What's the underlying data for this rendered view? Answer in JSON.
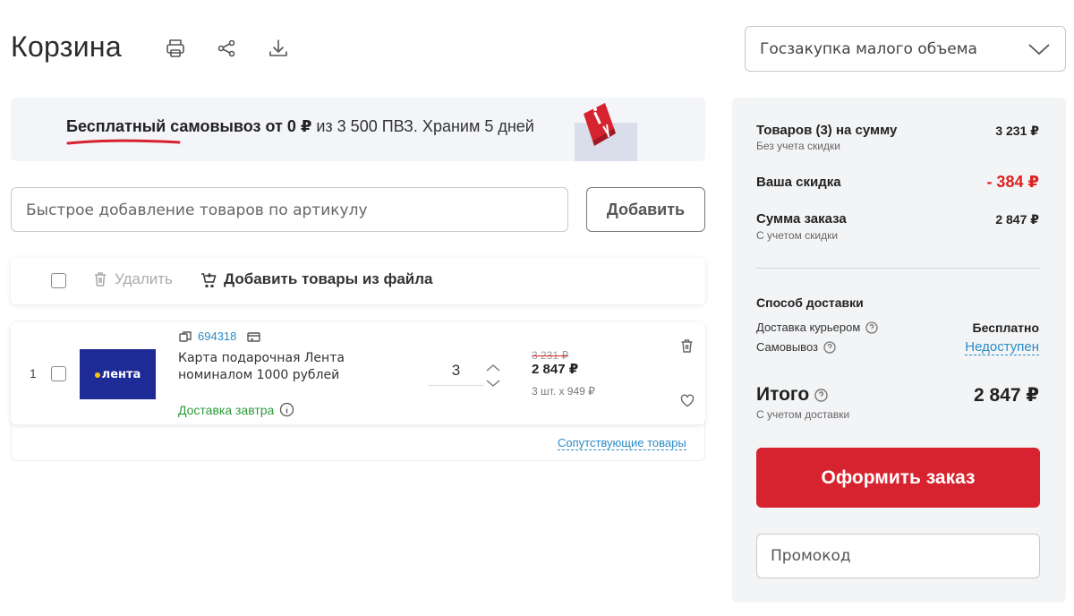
{
  "header": {
    "title": "Корзина",
    "icons": [
      "print-icon",
      "share-icon",
      "download-icon"
    ]
  },
  "purchase_type": {
    "selected": "Госзакупка малого объема"
  },
  "banner": {
    "bold_text": "Бесплатный самовывоз от 0 ₽",
    "text": " из 3 500 ПВЗ. Храним 5 дней"
  },
  "quick_add": {
    "placeholder": "Быстрое добавление товаров по артикулу",
    "button_label": "Добавить"
  },
  "toolbar": {
    "delete_label": "Удалить",
    "add_from_file_label": "Добавить товары из файла"
  },
  "cart": {
    "items": [
      {
        "index": "1",
        "image_label": "лента",
        "article": "694318",
        "name": "Карта подарочная Лента номиналом 1000 рублей",
        "delivery": "Доставка завтра",
        "quantity": "3",
        "price_old": "3 231 ₽",
        "price_new": "2 847 ₽",
        "price_unit": "3 шт. х 949 ₽"
      }
    ],
    "related_label": "Сопутствующие товары"
  },
  "summary": {
    "goods_label": "Товаров (3) на сумму",
    "goods_sub": "Без учета скидки",
    "goods_value": "3 231 ₽",
    "discount_label": "Ваша скидка",
    "discount_value": "- 384 ₽",
    "order_sum_label": "Сумма заказа",
    "order_sum_sub": "С учетом скидки",
    "order_sum_value": "2 847 ₽",
    "delivery_title": "Способ доставки",
    "courier_label": "Доставка курьером",
    "courier_value": "Бесплатно",
    "pickup_label": "Самовывоз",
    "pickup_value": "Недоступен",
    "total_label": "Итого",
    "total_sub": "С учетом доставки",
    "total_value": "2 847 ₽",
    "order_button": "Оформить заказ",
    "promo_placeholder": "Промокод"
  },
  "colors": {
    "accent_red": "#d7232f",
    "link_blue": "#2a8bc7",
    "delivery_green": "#2e9a3a"
  }
}
